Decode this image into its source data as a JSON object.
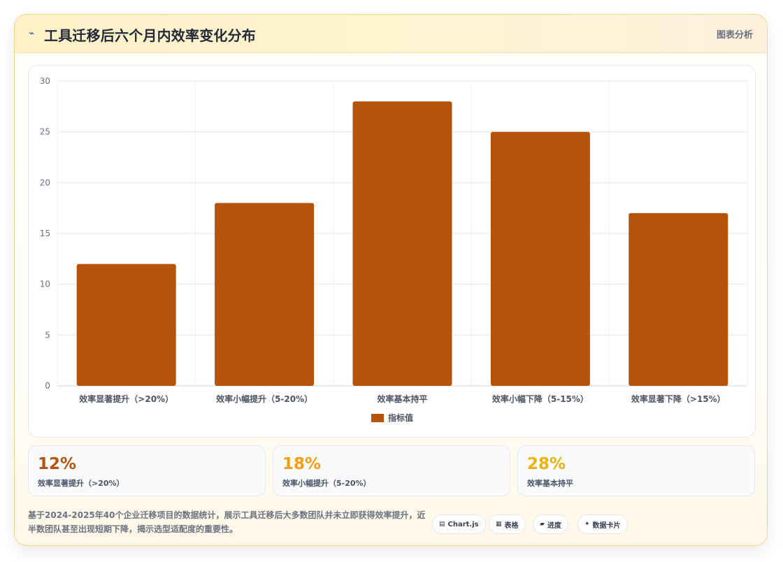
{
  "header": {
    "icon": "wave-icon",
    "title": "工具迁移后六个月内效率变化分布",
    "tag": "图表分析"
  },
  "chart_data": {
    "type": "bar",
    "categories": [
      "效率显著提升（>20%）",
      "效率小幅提升（5-20%）",
      "效率基本持平",
      "效率小幅下降（5-15%）",
      "效率显著下降（>15%）"
    ],
    "series": [
      {
        "name": "指标值",
        "values": [
          12,
          18,
          28,
          25,
          17
        ],
        "color": "#b45309"
      }
    ],
    "ylim": [
      0,
      30
    ],
    "yticks": [
      0,
      5,
      10,
      15,
      20,
      25,
      30
    ],
    "grid": true,
    "legend": "bottom"
  },
  "kpis": [
    {
      "value": "12%",
      "label": "效率显著提升（>20%）",
      "color": "#b45309"
    },
    {
      "value": "18%",
      "label": "效率小幅提升（5-20%）",
      "color": "#f59e0b"
    },
    {
      "value": "28%",
      "label": "效率基本持平",
      "color": "#eab308"
    }
  ],
  "footer": {
    "text": "基于2024-2025年40个企业迁移项目的数据统计，展示工具迁移后大多数团队并未立即获得效率提升，近半数团队甚至出现短期下降，揭示选型适配度的重要性。"
  },
  "pills": [
    {
      "icon": "chart-icon",
      "label": "Chart.js"
    },
    {
      "icon": "table-icon",
      "label": "表格"
    },
    {
      "icon": "progress-icon",
      "label": "进度"
    },
    {
      "icon": "card-icon",
      "label": "数据卡片"
    }
  ]
}
